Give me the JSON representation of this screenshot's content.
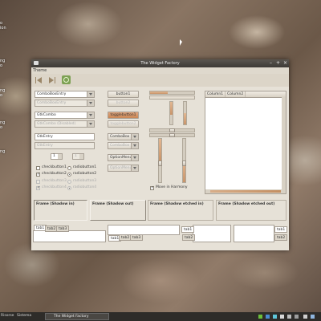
{
  "window": {
    "title": "The Widget Factory",
    "menu": [
      "Theme"
    ]
  },
  "desktop": {
    "left_labels": [
      "o",
      "ion",
      "ng",
      "o",
      "ng",
      "o",
      "ng",
      "o",
      "ng"
    ]
  },
  "left": {
    "combo_entry": "ComboBoxEntry",
    "combo_entry_disabled": "ComboBoxEntry",
    "gtk_combo": "GtkCombo",
    "gtk_combo_disabled": "GtkCombo (Disabled)",
    "entry": "GtkEntry",
    "entry_disabled": "GtkEntry",
    "spin1": "1",
    "spin2": "1",
    "check1": "checkbutton1",
    "check2": "checkbutton2",
    "check3": "checkbutton3",
    "check4": "checkbutton4",
    "radio1": "radiobutton1",
    "radio2": "radiobutton2",
    "radio3": "radiobutton3",
    "radio4": "radiobutton4"
  },
  "middle": {
    "button1": "button1",
    "button2": "button2",
    "toggle1": "togglebutton1",
    "toggle2": "togglebutton2",
    "combobox": "ComboBox",
    "combobox_disabled": "ComboBox",
    "optionmenu": "OptionMenu",
    "optionmenu_disabled": "OptionMenu"
  },
  "scales": {
    "move_in_harmony": "Move in Harmony"
  },
  "tree": {
    "columns": [
      "Column1",
      "Column2"
    ]
  },
  "frames": [
    "Frame (Shadow in)",
    "Frame (Shadow out)",
    "Frame (Shadow etched in)",
    "Frame (Shadow etched out)"
  ],
  "notebooks": {
    "nb1": [
      "tab1",
      "tab2",
      "tab3"
    ],
    "nb2": [
      "tab1",
      "tab2",
      "tab3"
    ],
    "nb3": [
      "tab1",
      "tab2"
    ],
    "nb4": [
      "tab1",
      "tab2"
    ]
  },
  "taskbar": {
    "item1": "Risorse",
    "item2": "Sistema",
    "window": "The Widget Factory"
  }
}
